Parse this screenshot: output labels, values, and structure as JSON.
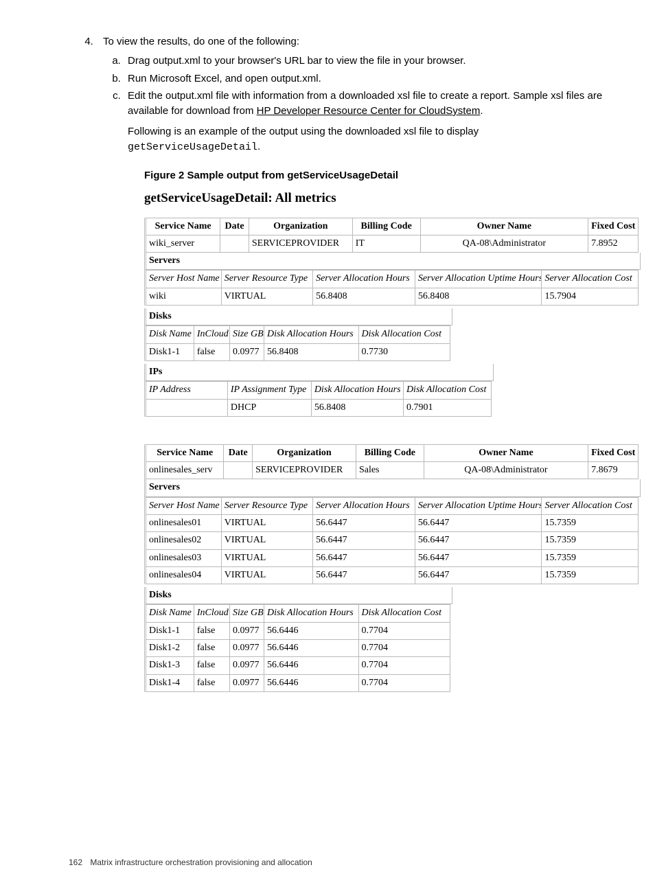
{
  "step4": {
    "intro": "To view the results, do one of the following:",
    "a": "Drag output.xml to your browser's URL bar to view the file in your browser.",
    "b": "Run Microsoft Excel, and open output.xml.",
    "c_pre": "Edit the output.xml file with information from a downloaded xsl file to create a report. Sample xsl files are available for download from ",
    "c_link": "HP Developer Resource Center for CloudSystem",
    "c_post": ".",
    "following": "Following is an example of the output using the downloaded xsl file to display ",
    "following_code": "getServiceUsageDetail",
    "following_end": "."
  },
  "figure_caption": "Figure 2 Sample output from getServiceUsageDetail",
  "section_title": "getServiceUsageDetail: All metrics",
  "svc_head": {
    "c1": "Service Name",
    "c2": "Date",
    "c3": "Organization",
    "c4": "Billing Code",
    "c5": "Owner Name",
    "c6": "Fixed Cost"
  },
  "servers_label": "Servers",
  "srv_head": {
    "c1": "Server Host Name",
    "c2": "Server Resource Type",
    "c3": "Server Allocation Hours",
    "c4": "Server Allocation Uptime Hours",
    "c5": "Server Allocation Cost"
  },
  "disks_label": "Disks",
  "dsk_head": {
    "c1": "Disk Name",
    "c2": "InCloud",
    "c3": "Size GB",
    "c4": "Disk Allocation Hours",
    "c5": "Disk Allocation Cost"
  },
  "ips_label": "IPs",
  "ip_head": {
    "c1": "IP Address",
    "c2": "IP Assignment Type",
    "c3": "Disk Allocation Hours",
    "c4": "Disk Allocation Cost"
  },
  "block1": {
    "service": {
      "name": "wiki_server",
      "date": "",
      "org": "SERVICEPROVIDER",
      "billing": "IT",
      "owner": "QA-08\\Administrator",
      "cost": "7.8952"
    },
    "servers": [
      {
        "host": "wiki",
        "type": "VIRTUAL",
        "hours": "56.8408",
        "uptime": "56.8408",
        "cost": "15.7904"
      }
    ],
    "disks": [
      {
        "name": "Disk1-1",
        "incloud": "false",
        "size": "0.0977",
        "hours": "56.8408",
        "cost": "0.7730"
      }
    ],
    "ips": [
      {
        "addr": "",
        "type": "DHCP",
        "hours": "56.8408",
        "cost": "0.7901"
      }
    ]
  },
  "block2": {
    "service": {
      "name": "onlinesales_serv",
      "date": "",
      "org": "SERVICEPROVIDER",
      "billing": "Sales",
      "owner": "QA-08\\Administrator",
      "cost": "7.8679"
    },
    "servers": [
      {
        "host": "onlinesales01",
        "type": "VIRTUAL",
        "hours": "56.6447",
        "uptime": "56.6447",
        "cost": "15.7359"
      },
      {
        "host": "onlinesales02",
        "type": "VIRTUAL",
        "hours": "56.6447",
        "uptime": "56.6447",
        "cost": "15.7359"
      },
      {
        "host": "onlinesales03",
        "type": "VIRTUAL",
        "hours": "56.6447",
        "uptime": "56.6447",
        "cost": "15.7359"
      },
      {
        "host": "onlinesales04",
        "type": "VIRTUAL",
        "hours": "56.6447",
        "uptime": "56.6447",
        "cost": "15.7359"
      }
    ],
    "disks": [
      {
        "name": "Disk1-1",
        "incloud": "false",
        "size": "0.0977",
        "hours": "56.6446",
        "cost": "0.7704"
      },
      {
        "name": "Disk1-2",
        "incloud": "false",
        "size": "0.0977",
        "hours": "56.6446",
        "cost": "0.7704"
      },
      {
        "name": "Disk1-3",
        "incloud": "false",
        "size": "0.0977",
        "hours": "56.6446",
        "cost": "0.7704"
      },
      {
        "name": "Disk1-4",
        "incloud": "false",
        "size": "0.0977",
        "hours": "56.6446",
        "cost": "0.7704"
      }
    ]
  },
  "footer": {
    "page": "162",
    "title": "Matrix infrastructure orchestration provisioning and allocation"
  }
}
